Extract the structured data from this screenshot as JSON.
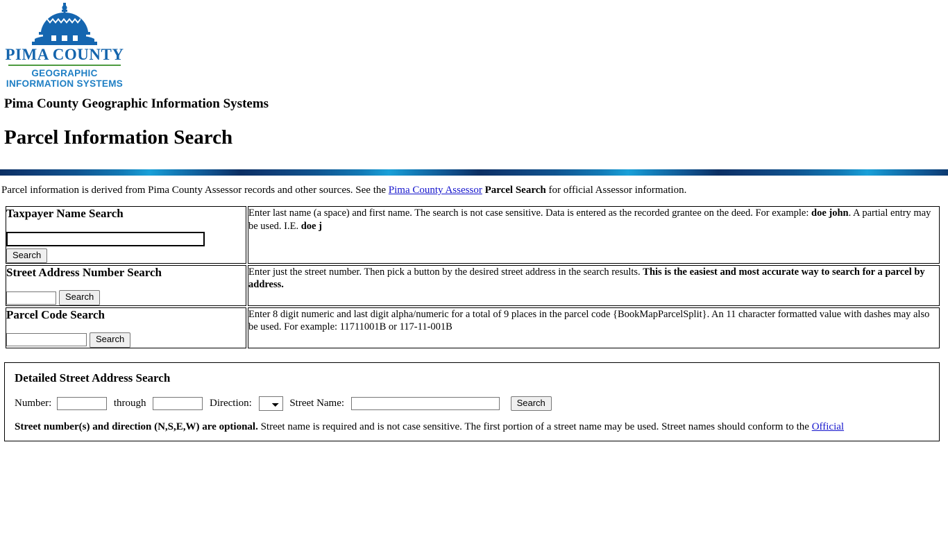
{
  "logo": {
    "icon": "courthouse-dome-icon",
    "name": "PIMA COUNTY",
    "sub_line1": "GEOGRAPHIC",
    "sub_line2": "INFORMATION SYSTEMS",
    "name_color": "#1565ad",
    "sub_color": "#1f7fc4",
    "rule_color": "#4d9a3f"
  },
  "header": {
    "site_title": "Pima County Geographic Information Systems",
    "page_title": "Parcel Information Search",
    "divider_colors": [
      "#0b2f63",
      "#1279b5",
      "#19a0d8"
    ]
  },
  "intro": {
    "text_before": "Parcel information is derived from Pima County Assessor records and other sources. See the ",
    "link_text": "Pima County Assessor",
    "bold_text": " Parcel Search",
    "text_after": " for official Assessor information.",
    "link_color": "#1414cc"
  },
  "search_rows": [
    {
      "title": "Taxpayer Name Search",
      "input_value": "",
      "input_focused": true,
      "button_label": "Search",
      "description_html": "Enter last name (a space) and first name. The search is not case sensitive. Data is entered as the recorded grantee on the deed. For example: <b>doe john</b>. A partial entry may be used. I.E. <b>doe j</b>"
    },
    {
      "title": "Street Address Number Search",
      "input_value": "",
      "input_focused": false,
      "button_label": "Search",
      "description_html": "Enter just the street number. Then pick a button by the desired street address in the search results. <b>This is the easiest and most accurate way to search for a parcel by address.</b>"
    },
    {
      "title": "Parcel Code Search",
      "input_value": "",
      "input_focused": false,
      "button_label": "Search",
      "description_html": "Enter 8 digit numeric and last digit alpha/numeric for a total of 9 places in the parcel code {BookMapParcelSplit}. An 11 character formatted value with dashes may also be used. For example: 11711001B or 117-11-001B"
    }
  ],
  "detailed": {
    "title": "Detailed Street Address Search",
    "number_label": "Number:",
    "number_value": "",
    "through_label": "through",
    "through_value": "",
    "direction_label": "Direction:",
    "direction_value": "",
    "direction_options": [
      "",
      "N",
      "S",
      "E",
      "W"
    ],
    "street_name_label": "Street Name:",
    "street_name_value": "",
    "button_label": "Search",
    "note_bold": "Street number(s) and direction (N,S,E,W) are optional.",
    "note_rest": " Street name is required and is not case sensitive. The first portion of a street name may be used. Street names should conform to the ",
    "note_link": "Official"
  }
}
